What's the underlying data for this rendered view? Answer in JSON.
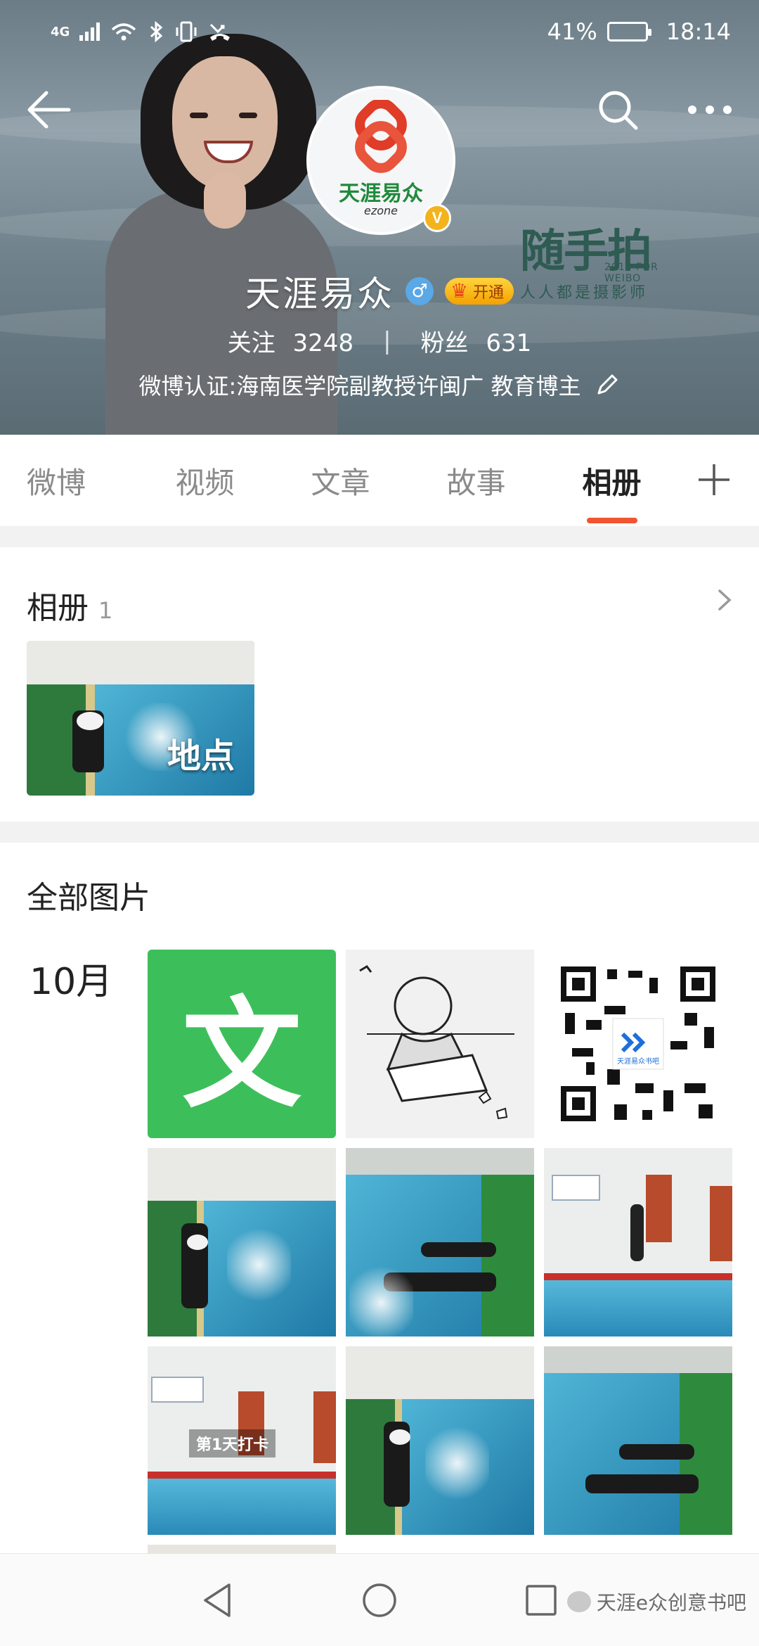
{
  "status_bar": {
    "network": "4G",
    "battery_percent": "41%",
    "time": "18:14"
  },
  "profile": {
    "name": "天涯易众",
    "avatar_text": "天涯易众",
    "avatar_subtext": "ezone",
    "verified_mark": "V",
    "vip_label": "开通",
    "following_label": "关注",
    "following_count": "3248",
    "followers_label": "粉丝",
    "followers_count": "631",
    "bio": "微博认证:海南医学院副教授许闽广 教育博主"
  },
  "cover_watermark": {
    "main": "随手拍",
    "subtitle": "2015 FOR WEIBO",
    "tagline": "人人都是摄影师"
  },
  "tabs": [
    {
      "label": "微博",
      "active": false
    },
    {
      "label": "视频",
      "active": false
    },
    {
      "label": "文章",
      "active": false
    },
    {
      "label": "故事",
      "active": false
    },
    {
      "label": "相册",
      "active": true
    }
  ],
  "album": {
    "title": "相册",
    "count": "1",
    "thumb_label": "地点"
  },
  "all_photos": {
    "title": "全部图片",
    "month": "10月",
    "app_icon_char": "文",
    "qr_caption": "天涯易众书吧",
    "overlay_caption": "第1天打卡"
  },
  "footer_watermark": "天涯e众创意书吧",
  "colors": {
    "accent": "#f0552f",
    "active_tab_text": "#222222",
    "inactive_tab_text": "#8a8a8a",
    "app_icon_green": "#3cbf5a"
  }
}
